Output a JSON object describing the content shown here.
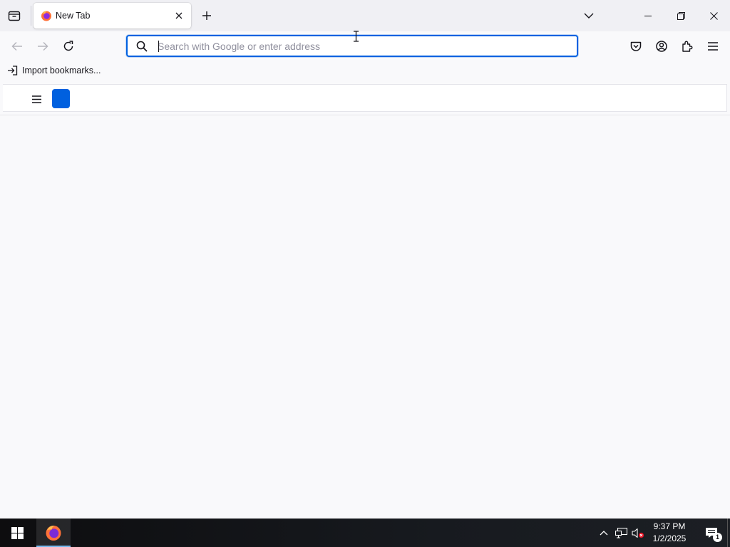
{
  "browser": {
    "tab": {
      "title": "New Tab"
    },
    "urlbar": {
      "placeholder": "Search with Google or enter address",
      "value": ""
    },
    "bookmarks_toolbar": {
      "import_label": "Import bookmarks..."
    }
  },
  "taskbar": {
    "clock": {
      "time": "9:37 PM",
      "date": "1/2/2025"
    },
    "notifications": {
      "count": "1"
    }
  },
  "colors": {
    "accent": "#0061e0",
    "tab_strip_bg": "#f0f0f4",
    "content_bg": "#f9f9fb",
    "taskbar_bg": "#101215"
  },
  "icons": {
    "tab_bar": [
      "firefox-view-icon",
      "firefox-favicon",
      "close-icon",
      "plus-icon",
      "chevron-down-icon",
      "minimize-icon",
      "restore-icon",
      "window-close-icon"
    ],
    "navbar": [
      "back-arrow-icon",
      "forward-arrow-icon",
      "reload-icon",
      "search-icon",
      "pocket-icon",
      "account-icon",
      "extensions-icon",
      "hamburger-menu-icon"
    ],
    "taskbar": [
      "windows-start-icon",
      "firefox-icon",
      "chevron-up-icon",
      "network-icon",
      "speaker-muted-icon",
      "notification-icon"
    ]
  }
}
